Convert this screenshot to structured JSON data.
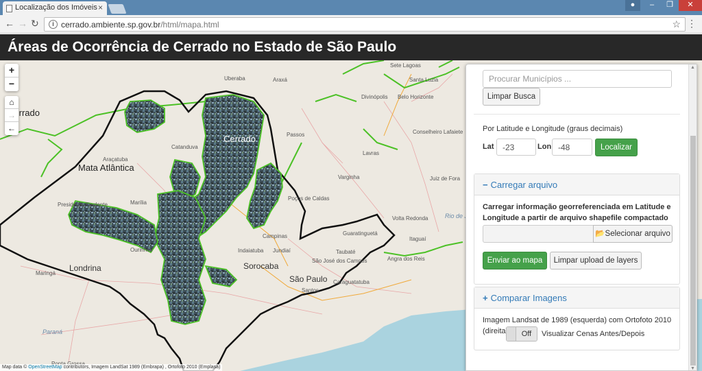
{
  "browser": {
    "tab_title": "Localização dos Imóveis",
    "tab_close": "×",
    "url_host": "cerrado.ambiente.sp.gov.br",
    "url_path": "/html/mapa.html",
    "info_glyph": "i",
    "star_glyph": "☆",
    "menu_glyph": "⋮",
    "back_glyph": "←",
    "forward_glyph": "→",
    "reload_glyph": "↻",
    "window_buttons": {
      "user": "●",
      "minimize": "–",
      "maximize": "❐",
      "close": "✕"
    }
  },
  "header": {
    "title": "Áreas de Ocorrência de Cerrado no Estado de São Paulo"
  },
  "map": {
    "zoom_in": "+",
    "zoom_out": "−",
    "home_glyph": "⌂",
    "next_glyph": "→",
    "prev_glyph": "←",
    "region_labels": {
      "cerrado": "Cerrado",
      "mata_atlantica": "Mata Atlântica",
      "cerrado_left": "Cerrado"
    },
    "city_labels": {
      "sete_lagoas": "Sete Lagoas",
      "santa_luzia": "Santa Luzia",
      "belo_horizonte": "Belo Horizonte",
      "uberaba": "Uberaba",
      "araxa": "Araxá",
      "divinopolis": "Divinópolis",
      "conselheiro_lafaiete": "Conselheiro Lafaiete",
      "passos": "Passos",
      "catanduva": "Catanduva",
      "aracatuba": "Araçatuba",
      "lavras": "Lavras",
      "varginha": "Varginha",
      "juiz_de_fora": "Juiz de Fora",
      "presidente_prudente": "Presidente Prudente",
      "marilia": "Marília",
      "pocos_de_caldas": "Poços de Caldas",
      "campinas": "Campinas",
      "guaratingueta": "Guaratinguetá",
      "londrina": "Londrina",
      "indaiatuba": "Indaiatuba",
      "jundiai": "Jundiaí",
      "taubate": "Taubaté",
      "sorocaba": "Sorocaba",
      "sao_jose_dos_campos": "São José dos Campos",
      "sao_paulo": "São Paulo",
      "santos": "Santos",
      "caraguatatuba": "Caraguatatuba",
      "maringa": "Maringá",
      "ourinhos": "Ourinhos",
      "parana": "Paraná",
      "itaquai": "Itaguaí",
      "rio_de_janeiro": "Rio de J",
      "volta_redonda": "Volta Redonda",
      "angra": "Angra dos Reis",
      "ponta_grossa": "Ponta Grossa"
    },
    "attribution_prefix": "Map data ©",
    "attribution_link": "OpenStreetMap",
    "attribution_rest": "contributors, Imagem LandSat 1989 (Embrapa) , Ortofoto 2010 (Emplasa)"
  },
  "panel": {
    "search_placeholder": "Procurar Municípios ...",
    "clear_search_label": "Limpar Busca",
    "latlon_title": "Por Latitude e Longitude (graus decimais)",
    "lat_label": "Lat",
    "lat_value": "-23",
    "lon_label": "Lon",
    "lon_value": "-48",
    "locate_label": "Localizar",
    "upload_section": {
      "toggle_symbol": "−",
      "title": "Carregar arquivo",
      "description": "Carregar informação georreferenciada em Latitude e Longitude a partir de arquivo shapefile compactado (*.zip)",
      "select_file_label": "Selecionar arquivo",
      "folder_glyph": "📂",
      "send_label": "Enviar ao mapa",
      "clear_layers_label": "Limpar upload de layers"
    },
    "compare_section": {
      "toggle_symbol": "+",
      "title": "Comparar Imagens",
      "description": "Imagem Landsat de 1989 (esquerda) com Ortofoto 2010 (direita)",
      "toggle_state": "Off",
      "toggle_caption": "Visualizar Cenas Antes/Depois"
    }
  },
  "colors": {
    "header_bg": "#282828",
    "accent": "#337ab7",
    "green_button": "#45a14a",
    "boundary_green": "#4cc126",
    "map_bg": "#ede9e1",
    "sea": "#aad3df"
  }
}
